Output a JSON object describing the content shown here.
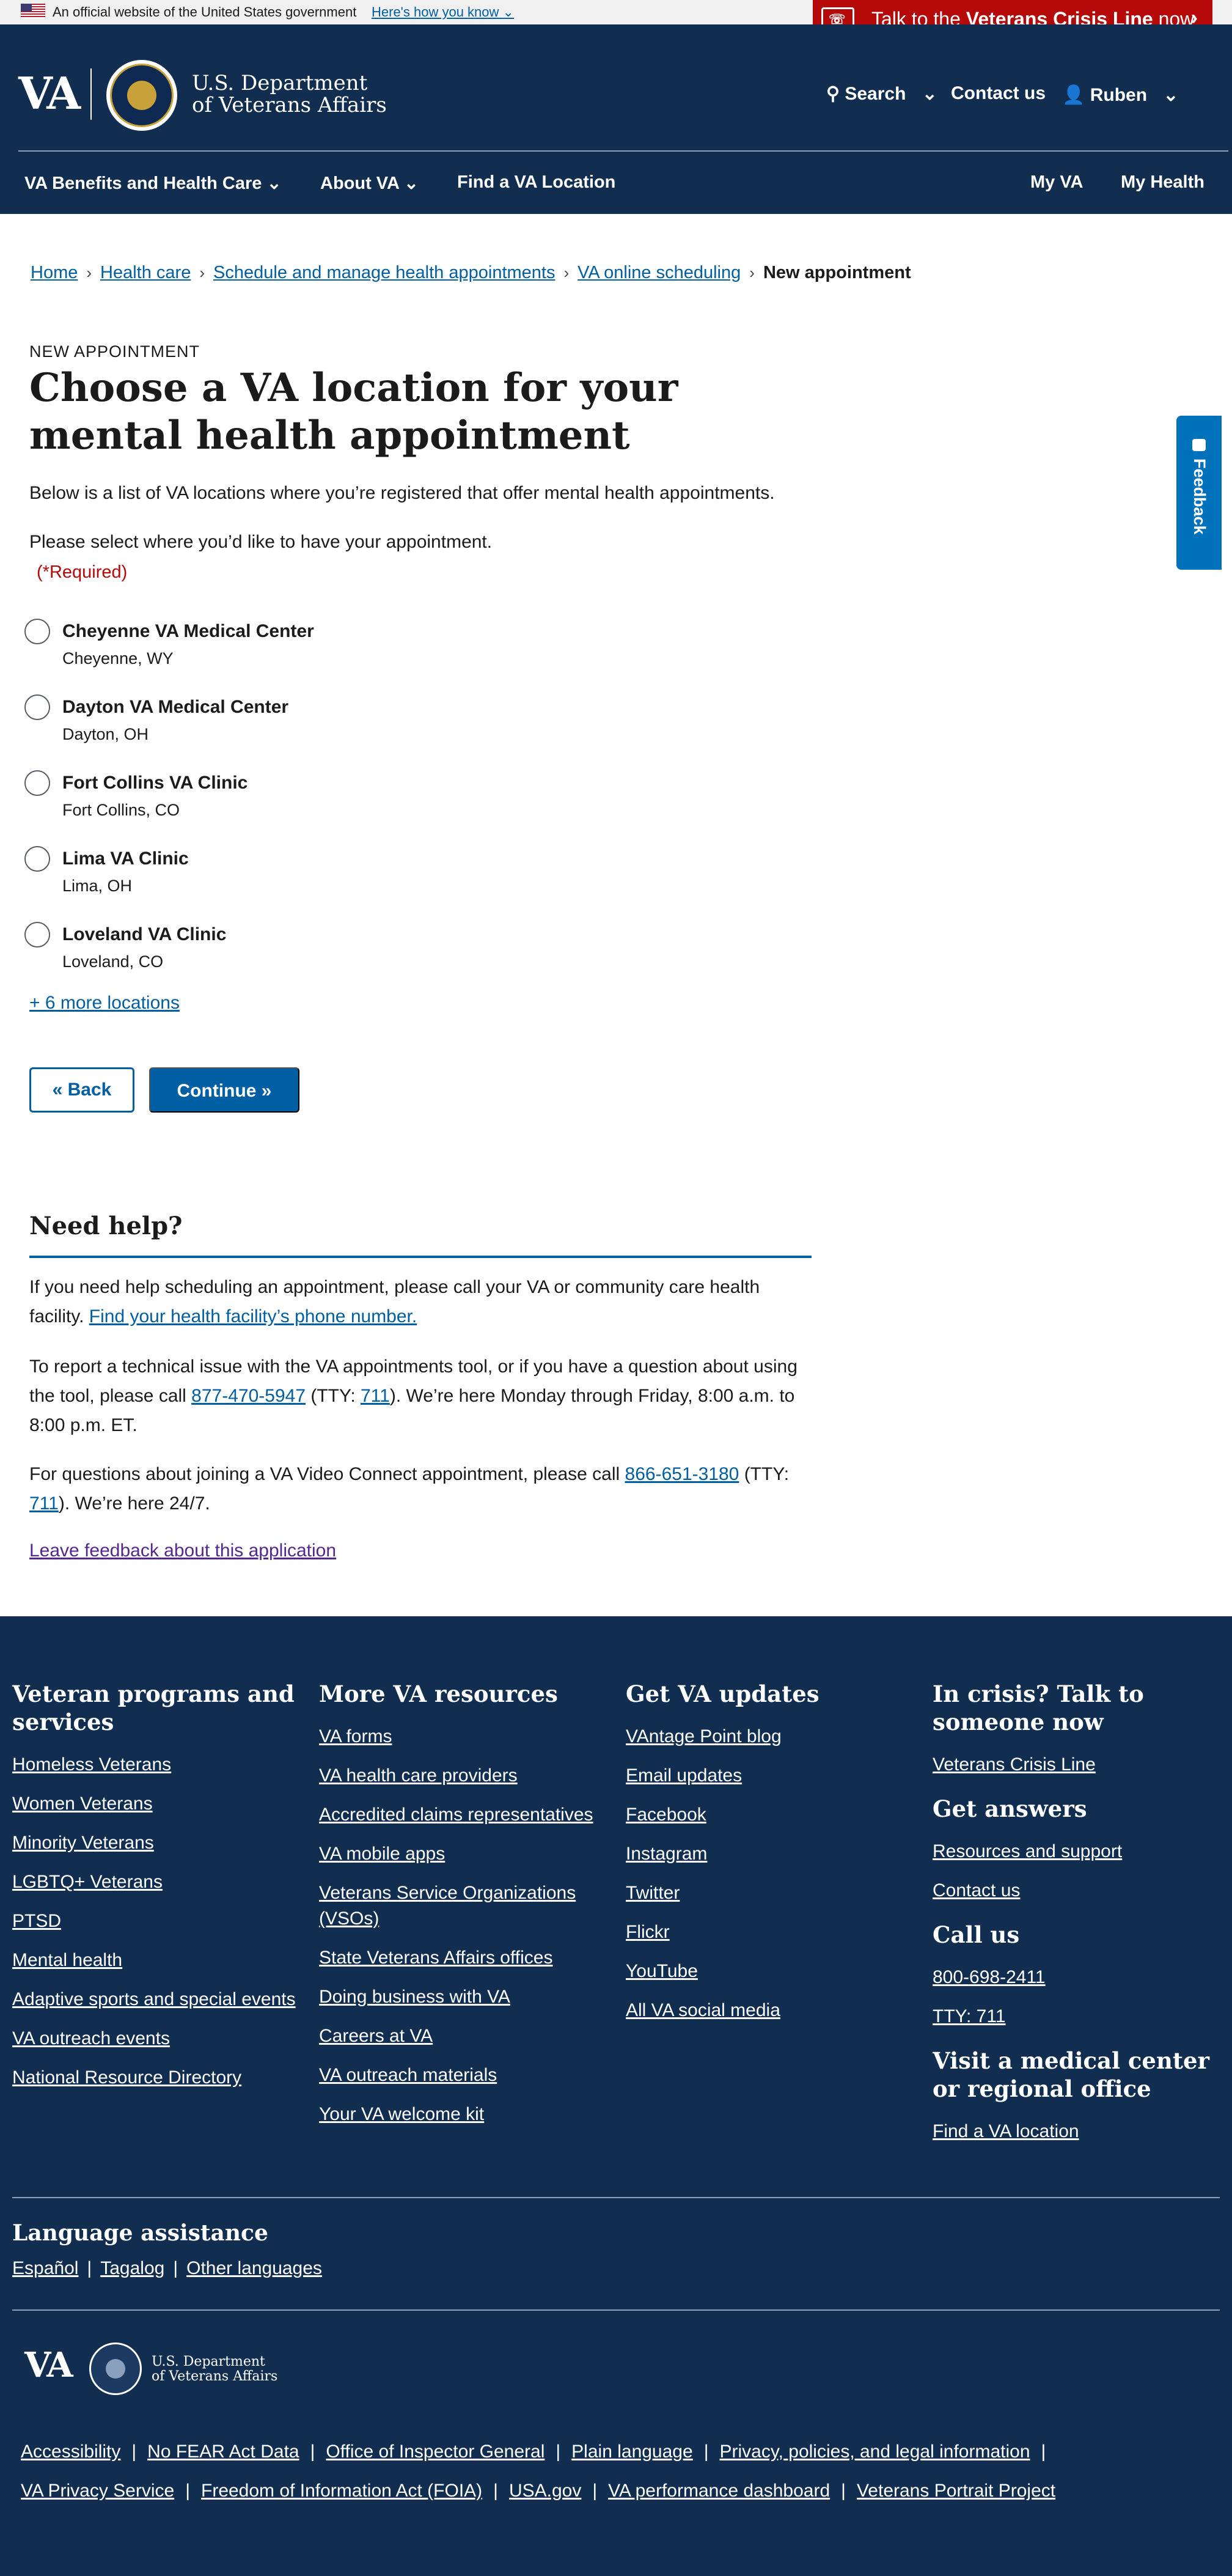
{
  "gov_banner": {
    "official_text": "An official website of the United States government",
    "how_know": "Here's how you know"
  },
  "crisis": {
    "prefix": "Talk to the ",
    "bold": "Veterans Crisis Line",
    "suffix": " now"
  },
  "header": {
    "logo": "VA",
    "dept_line1": "U.S. Department",
    "dept_line2": "of Veterans Affairs",
    "search": "Search",
    "contact": "Contact us",
    "user": "Ruben"
  },
  "nav": {
    "benefits": "VA Benefits and Health Care",
    "about": "About VA",
    "find": "Find a VA Location",
    "my_va": "My VA",
    "my_health": "My Health"
  },
  "breadcrumb": [
    "Home",
    "Health care",
    "Schedule and manage health appointments",
    "VA online scheduling",
    "New appointment"
  ],
  "main": {
    "eyebrow": "NEW APPOINTMENT",
    "title": "Choose a VA location for your mental health appointment",
    "intro": "Below is a list of VA locations where you’re registered that offer mental health appointments.",
    "select_label": "Please select where you’d like to have your appointment.",
    "required": "(*Required)",
    "locations": [
      {
        "name": "Cheyenne VA Medical Center",
        "city": "Cheyenne, WY"
      },
      {
        "name": "Dayton VA Medical Center",
        "city": "Dayton, OH"
      },
      {
        "name": "Fort Collins VA Clinic",
        "city": "Fort Collins, CO"
      },
      {
        "name": "Lima VA Clinic",
        "city": "Lima, OH"
      },
      {
        "name": "Loveland VA Clinic",
        "city": "Loveland, CO"
      }
    ],
    "more_locations": "+ 6 more locations",
    "back": "« Back",
    "continue": "Continue »"
  },
  "help": {
    "title": "Need help?",
    "p1_text": "If you need help scheduling an appointment, please call your VA or community care health facility. ",
    "p1_link": "Find your health facility’s phone number.",
    "p2_a": "To report a technical issue with the VA appointments tool, or if you have a question about using the tool, please call ",
    "p2_phone": "877-470-5947",
    "p2_b": " (TTY: ",
    "p2_tty": "711",
    "p2_c": "). We’re here Monday through Friday, 8:00 a.m. to 8:00 p.m. ET.",
    "p3_a": "For questions about joining a VA Video Connect appointment, please call ",
    "p3_phone": "866-651-3180",
    "p3_b": " (TTY: ",
    "p3_tty": "711",
    "p3_c": "). We’re here 24/7.",
    "leave_feedback": "Leave feedback about this application"
  },
  "feedback_tab": "Feedback",
  "footer": {
    "col1": {
      "title": "Veteran programs and services",
      "links": [
        "Homeless Veterans",
        "Women Veterans",
        "Minority Veterans",
        "LGBTQ+ Veterans",
        "PTSD",
        "Mental health",
        "Adaptive sports and special events",
        "VA outreach events",
        "National Resource Directory"
      ]
    },
    "col2": {
      "title": "More VA resources",
      "links": [
        "VA forms",
        "VA health care providers",
        "Accredited claims representatives",
        "VA mobile apps",
        "Veterans Service Organizations (VSOs)",
        "State Veterans Affairs offices",
        "Doing business with VA",
        "Careers at VA",
        "VA outreach materials",
        "Your VA welcome kit"
      ]
    },
    "col3": {
      "title": "Get VA updates",
      "links": [
        "VAntage Point blog",
        "Email updates",
        "Facebook",
        "Instagram",
        "Twitter",
        "Flickr",
        "YouTube",
        "All VA social media"
      ]
    },
    "col4": {
      "crisis_title": "In crisis? Talk to someone now",
      "crisis_link": "Veterans Crisis Line",
      "answers_title": "Get answers",
      "answers_links": [
        "Resources and support",
        "Contact us"
      ],
      "call_title": "Call us",
      "call_links": [
        "800-698-2411",
        "TTY: 711"
      ],
      "visit_title": "Visit a medical center or regional office",
      "visit_link": "Find a VA location"
    },
    "language_title": "Language assistance",
    "languages": [
      "Español",
      "Tagalog",
      "Other languages"
    ],
    "logo": "VA",
    "dept_line1": "U.S. Department",
    "dept_line2": "of Veterans Affairs",
    "legal_row1": [
      "Accessibility",
      "No FEAR Act Data",
      "Office of Inspector General",
      "Plain language",
      "Privacy, policies, and legal information"
    ],
    "legal_row2": [
      "VA Privacy Service",
      "Freedom of Information Act (FOIA)",
      "USA.gov",
      "VA performance dashboard",
      "Veterans Portrait Project"
    ]
  }
}
